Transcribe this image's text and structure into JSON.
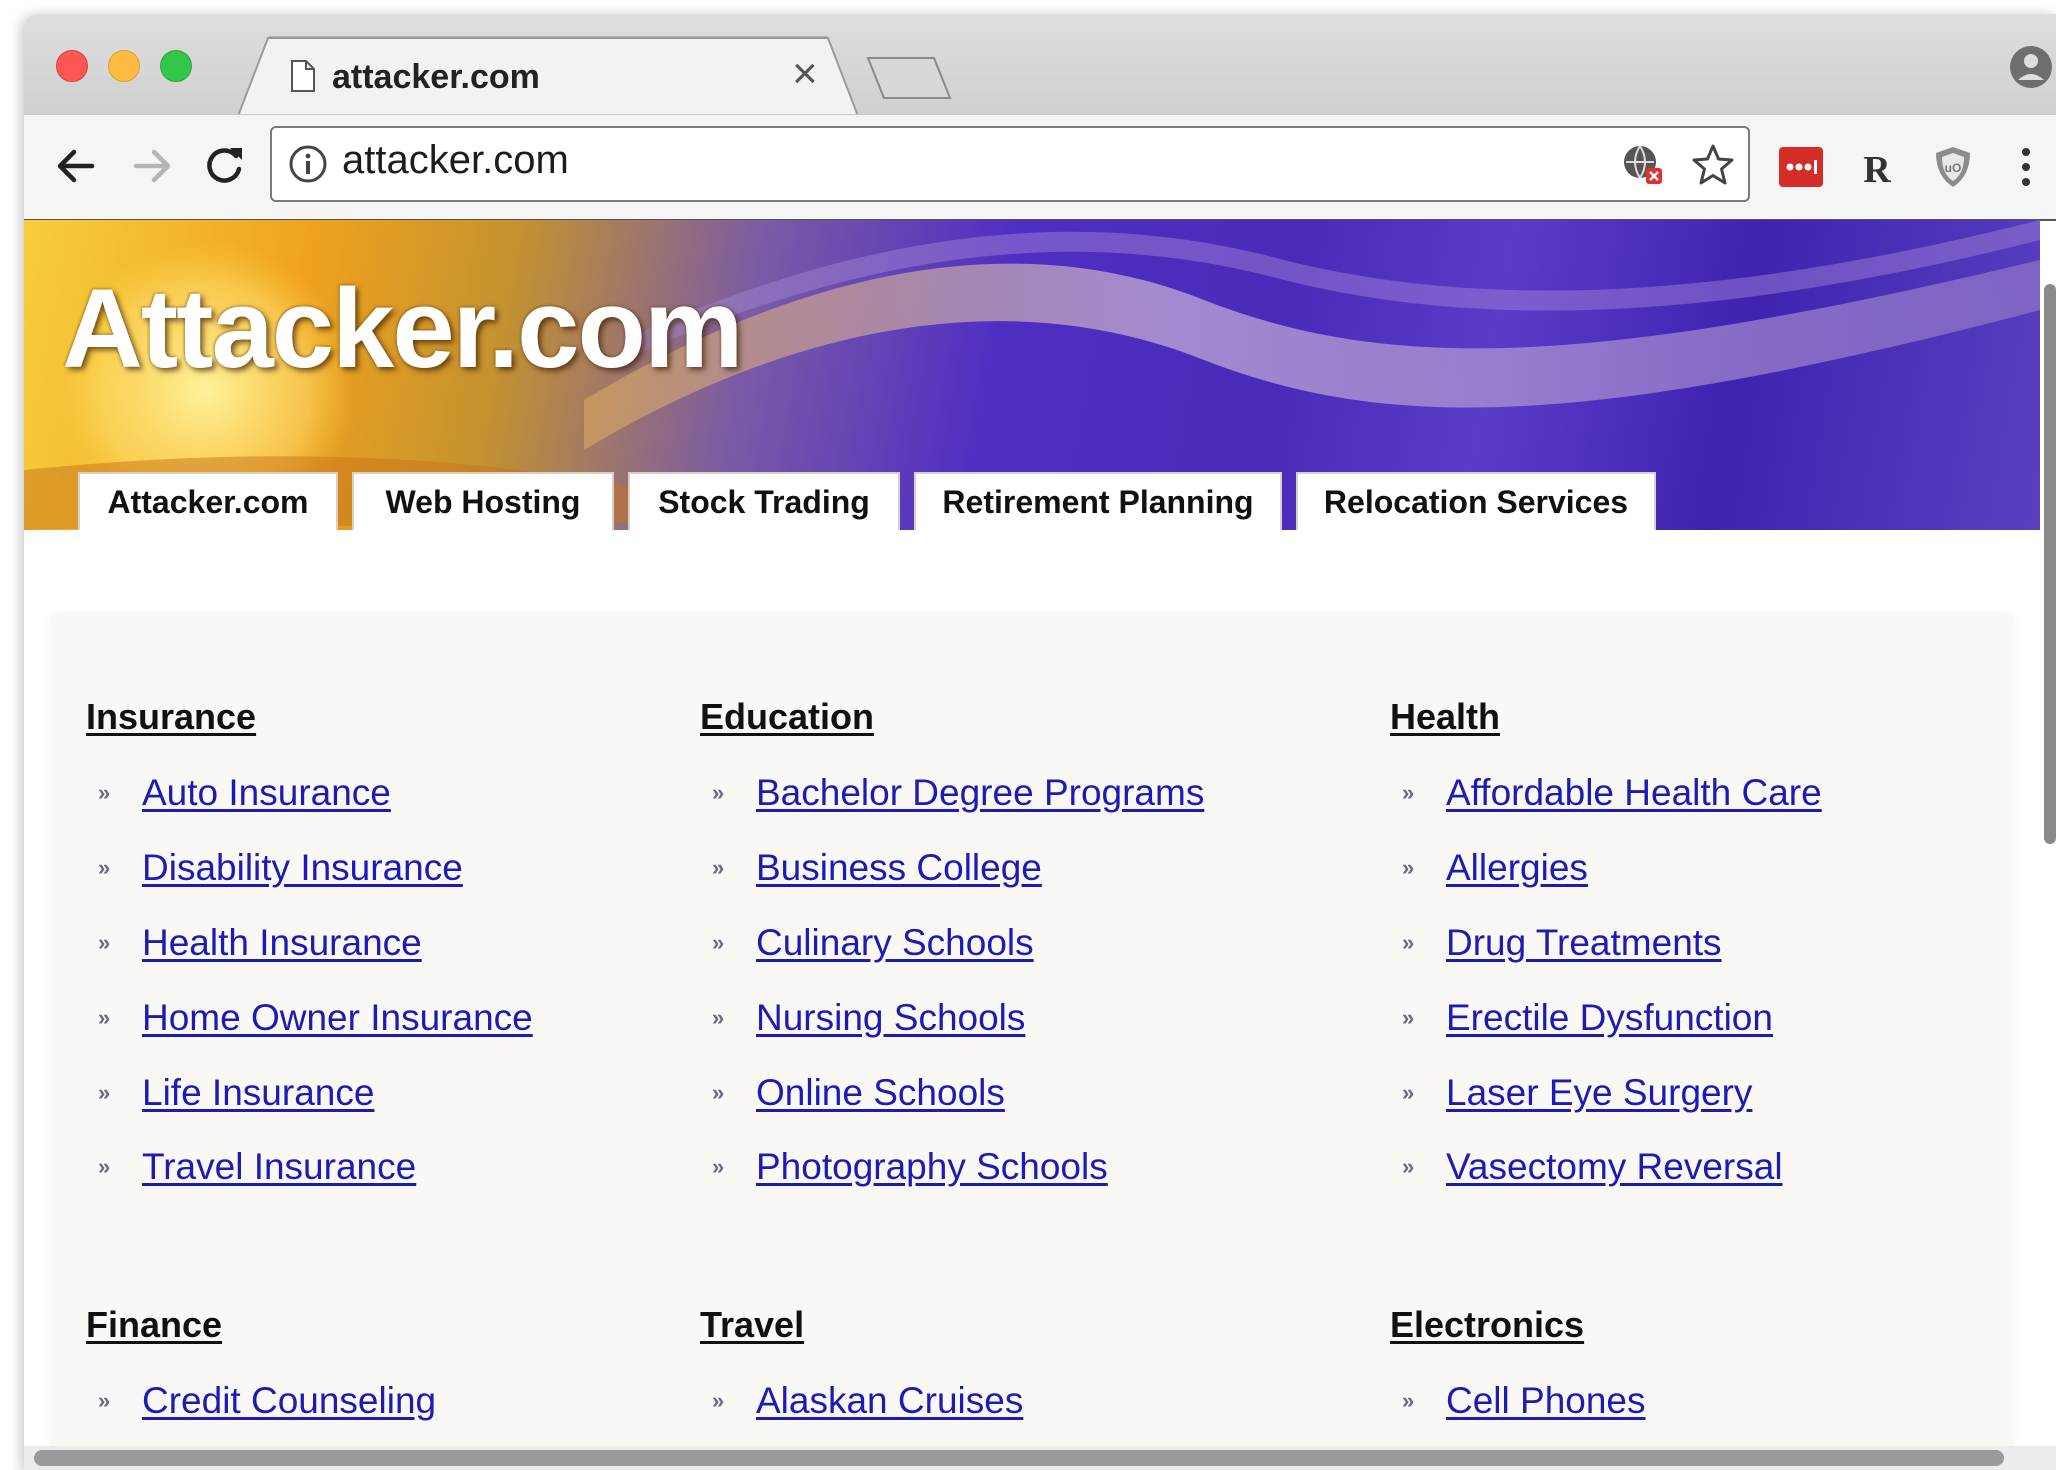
{
  "browser": {
    "tab_title": "attacker.com",
    "tab_close": "×",
    "url": "attacker.com",
    "icons": {
      "back": "back-arrow-icon",
      "forward": "forward-arrow-icon",
      "reload": "reload-icon",
      "info": "info-icon",
      "translate": "translate-icon",
      "bookmark": "star-icon",
      "menu": "kebab-menu-icon",
      "profile": "profile-icon"
    },
    "extensions": {
      "lastpass": "lastpass-icon",
      "r": "R",
      "shield": "ublock-shield-icon"
    }
  },
  "site": {
    "logo": "Attacker.com",
    "nav_tabs": [
      {
        "label": "Attacker.com"
      },
      {
        "label": "Web Hosting"
      },
      {
        "label": "Stock Trading"
      },
      {
        "label": "Retirement Planning"
      },
      {
        "label": "Relocation Services"
      }
    ],
    "bullet": "»",
    "categories": [
      {
        "heading": "Insurance",
        "links": [
          "Auto Insurance",
          "Disability Insurance",
          "Health Insurance",
          "Home Owner Insurance",
          "Life Insurance",
          "Travel Insurance"
        ]
      },
      {
        "heading": "Education",
        "links": [
          "Bachelor Degree Programs",
          "Business College",
          "Culinary Schools",
          "Nursing Schools",
          "Online Schools",
          "Photography Schools"
        ]
      },
      {
        "heading": "Health",
        "links": [
          "Affordable Health Care",
          "Allergies",
          "Drug Treatments",
          "Erectile Dysfunction",
          "Laser Eye Surgery",
          "Vasectomy Reversal"
        ]
      },
      {
        "heading": "Finance",
        "links": [
          "Credit Counseling"
        ]
      },
      {
        "heading": "Travel",
        "links": [
          "Alaskan Cruises"
        ]
      },
      {
        "heading": "Electronics",
        "links": [
          "Cell Phones"
        ]
      }
    ]
  },
  "colors": {
    "link": "#1b1bb5",
    "banner_purple": "#4a2ab8",
    "banner_gold": "#f0a21e"
  }
}
